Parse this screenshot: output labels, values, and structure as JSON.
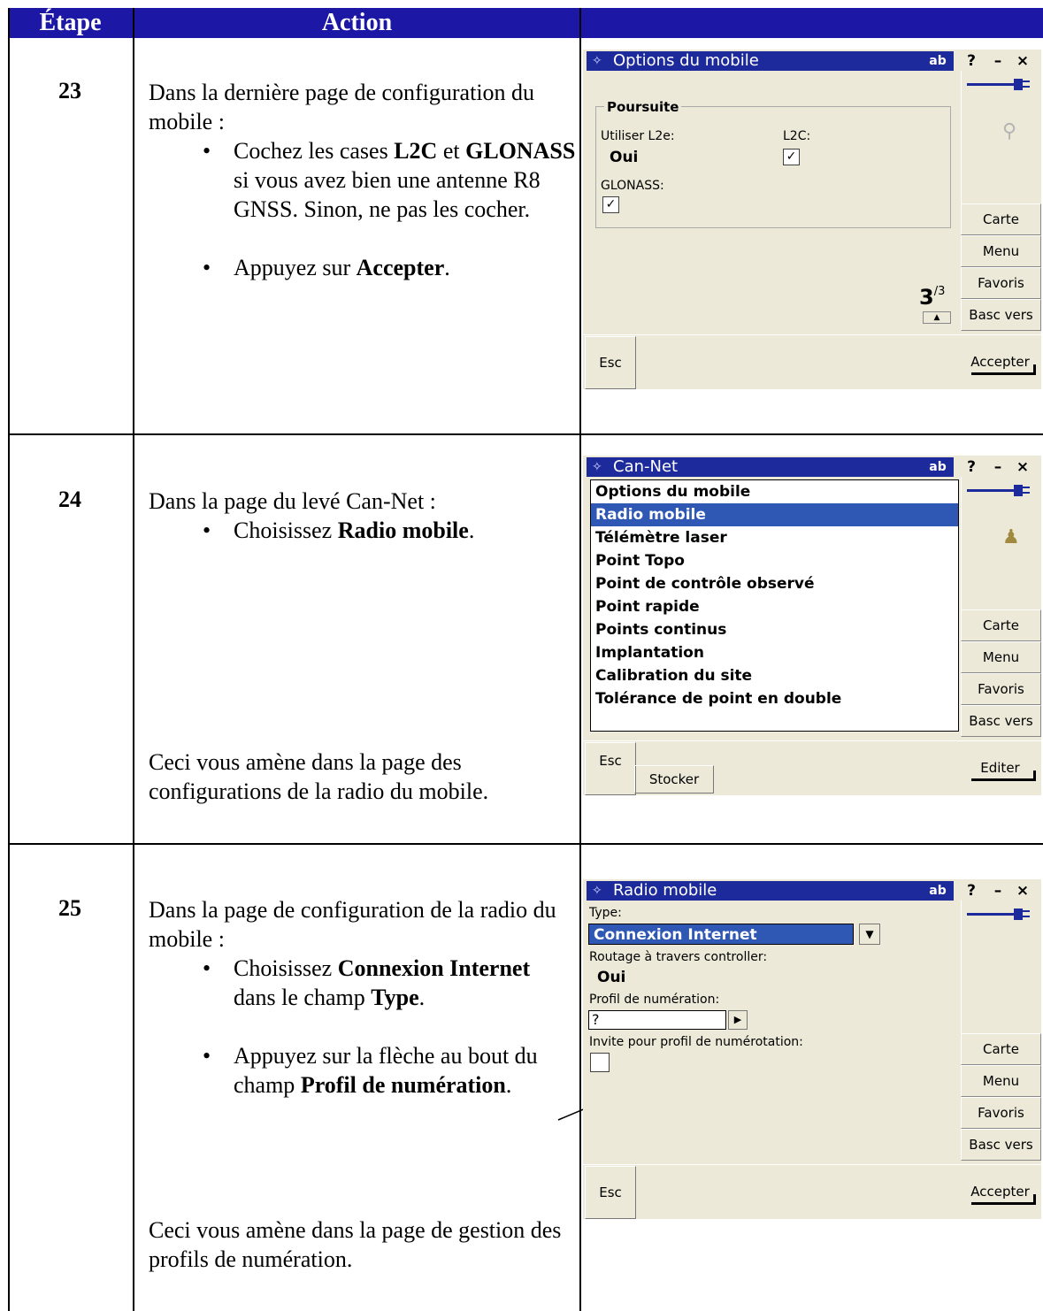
{
  "table": {
    "headers": {
      "step": "Étape",
      "action": "Action"
    }
  },
  "steps": [
    {
      "number": "23",
      "intro": "Dans la dernière page de configuration du mobile :",
      "bullets": [
        {
          "pre": "Cochez les cases ",
          "b1": "L2C",
          "mid": " et ",
          "b2": "GLONASS",
          "post": " si vous avez bien une antenne R8 GNSS. Sinon, ne pas les cocher."
        },
        {
          "pre": "Appuyez sur ",
          "b1": "Accepter",
          "post": "."
        }
      ]
    },
    {
      "number": "24",
      "intro": "Dans la page du levé Can-Net :",
      "bullets": [
        {
          "pre": "Choisissez ",
          "b1": "Radio mobile",
          "post": "."
        }
      ],
      "outro": "Ceci vous amène dans la page des configurations de la radio du mobile."
    },
    {
      "number": "25",
      "intro": "Dans la page de configuration de la radio du mobile :",
      "bullets": [
        {
          "pre": "Choisissez ",
          "b1": "Connexion Internet",
          "mid": " dans le champ ",
          "b2": "Type",
          "post": "."
        },
        {
          "pre": "Appuyez sur la flèche au bout du champ ",
          "b1": "Profil de numération",
          "post": "."
        }
      ],
      "outro": "Ceci vous amène dans la page de gestion des profils de numération."
    }
  ],
  "common": {
    "ab": "ab",
    "help": "?",
    "minimize": "–",
    "close": "×",
    "carte": "Carte",
    "menu": "Menu",
    "favoris": "Favoris",
    "basc": "Basc vers",
    "esc": "Esc"
  },
  "screen1": {
    "title": "Options du mobile",
    "group": "Poursuite",
    "l2e_label": "Utiliser L2e:",
    "l2e_value": "Oui",
    "l2c_label": "L2C:",
    "l2c_checked": "✓",
    "glonass_label": "GLONASS:",
    "glonass_checked": "✓",
    "page_num": "3",
    "page_total": "/3",
    "accept": "Accepter"
  },
  "screen2": {
    "title": "Can-Net",
    "items": [
      "Options du mobile",
      "Radio mobile",
      "Télémètre laser",
      "Point Topo",
      "Point de contrôle observé",
      "Point rapide",
      "Points continus",
      "Implantation",
      "Calibration du site",
      "Tolérance de point en double"
    ],
    "selected_index": 1,
    "store": "Stocker",
    "edit": "Editer"
  },
  "screen3": {
    "title": "Radio mobile",
    "type_label": "Type:",
    "type_value": "Connexion Internet",
    "routing_label": "Routage à travers controller:",
    "routing_value": "Oui",
    "profile_label": "Profil de numération:",
    "profile_value": "?",
    "invite_label": "Invite pour profil de numérotation:",
    "accept": "Accepter"
  }
}
